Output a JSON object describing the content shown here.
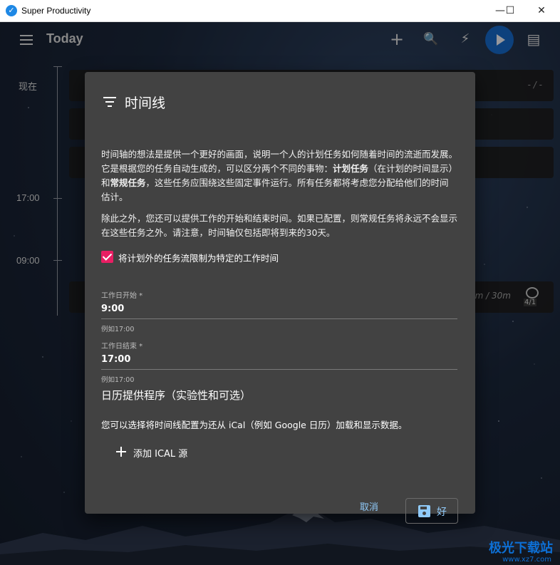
{
  "window": {
    "title": "Super Productivity",
    "minimize": "—",
    "maximize": "☐",
    "close": "✕"
  },
  "toolbar": {
    "page_title": "Today",
    "add_symbol": "+",
    "search_symbol": "🔍",
    "flash_symbol": "⚡",
    "chat_symbol": "▤"
  },
  "timeline": {
    "labels": [
      "现在",
      "17:00",
      "09:00"
    ],
    "card_meta_top": "- / -",
    "card_meta_bottom": "m / 30m",
    "alarm_badge": "4/1"
  },
  "dialog": {
    "title": "时间线",
    "para1_parts": [
      "时间轴的想法是提供一个更好的画面，说明一个人的计划任务如何随着时间的流逝而发展。它是根据您的任务自动生成的，可以区分两个不同的事物：",
      "计划任务",
      "（在计划的时间显示）和",
      "常规任务",
      "，这些任务应围绕这些固定事件运行。所有任务都将考虑您分配给他们的时间估计。"
    ],
    "para2": "除此之外，您还可以提供工作的开始和结束时间。如果已配置，则常规任务将永远不会显示在这些任务之外。请注意，时间轴仅包括即将到来的30天。",
    "checkbox_label": "将计划外的任务流限制为特定的工作时间",
    "checkbox_checked": true,
    "work_start": {
      "label": "工作日开始 *",
      "value": "9:00",
      "hint": "例如17:00"
    },
    "work_end": {
      "label": "工作日结束 *",
      "value": "17:00",
      "hint": "例如17:00"
    },
    "calendar_section_title": "日历提供程序（实验性和可选）",
    "calendar_desc": "您可以选择将时间线配置为还从 iCal（例如 Google 日历）加载和显示数据。",
    "add_ical_label": "添加 ICAL 源",
    "cancel_label": "取消",
    "ok_label": "好"
  },
  "watermark": {
    "text": "极光下载站",
    "sub": "www.xz7.com"
  },
  "colors": {
    "accent_blue": "#1565c0",
    "checkbox_pink": "#e91e63",
    "dialog_bg": "#424242",
    "link_blue": "#90caf9"
  },
  "icons": [
    "app-icon",
    "menu-icon",
    "add-icon",
    "search-icon",
    "flash-icon",
    "play-icon",
    "chat-icon",
    "filter-icon",
    "plus-icon",
    "save-icon",
    "alarm-icon"
  ]
}
